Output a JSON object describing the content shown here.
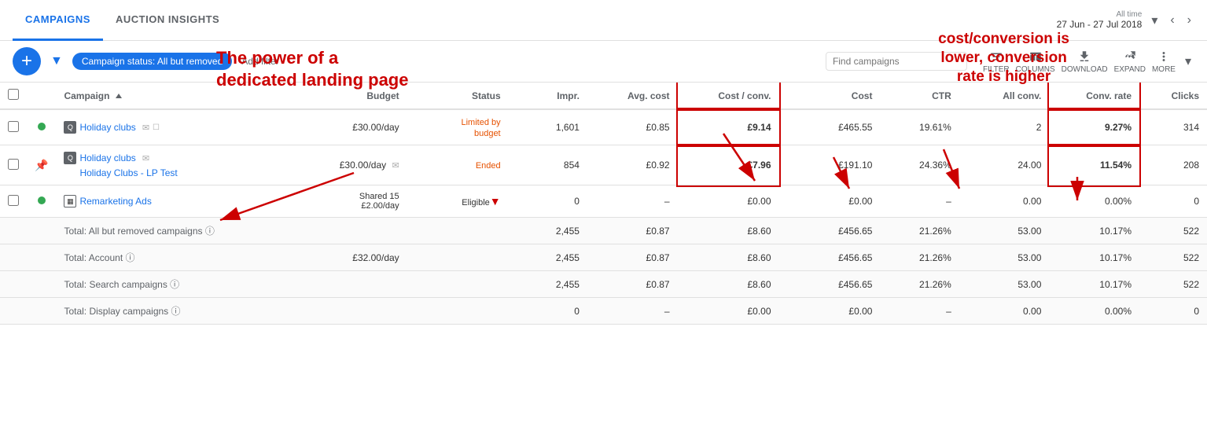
{
  "tabs": [
    {
      "id": "campaigns",
      "label": "CAMPAIGNS",
      "active": true
    },
    {
      "id": "auction-insights",
      "label": "AUCTION INSIGHTS",
      "active": false
    }
  ],
  "dateRange": {
    "allTime": "All time",
    "value": "27 Jun - 27 Jul 2018"
  },
  "toolbar": {
    "addLabel": "+",
    "filterTag": "Campaign status: All but removed",
    "addFilterLabel": "Add filter",
    "searchPlaceholder": "Find campaigns",
    "filterLabel": "FILTER",
    "columnsLabel": "COLUMNS",
    "downloadLabel": "DOWNLOAD",
    "expandLabel": "EXPAND",
    "moreLabel": "MORE"
  },
  "annotation1": "The power of a\ndedicated landing page",
  "annotation2": "cost/conversion is\nlower, conversion\nrate is higher",
  "table": {
    "headers": [
      "",
      "",
      "Campaign ↑",
      "Budget",
      "Status",
      "Impr.",
      "Avg. cost",
      "Cost / conv.",
      "Cost",
      "CTR",
      "All conv.",
      "Conv. rate",
      "Clicks"
    ],
    "rows": [
      {
        "checkbox": true,
        "status_dot": "green",
        "icon": "search",
        "campaign": "Holiday clubs",
        "campaign_sub": "",
        "budget": "£30.00/day",
        "status": "Limited by budget",
        "impr": "1,601",
        "avg_cost": "£0.85",
        "cost_conv": "£9.14",
        "cost": "£465.55",
        "ctr": "19.61%",
        "all_conv": "2",
        "conv_rate": "9.27%",
        "clicks": "314"
      },
      {
        "checkbox": true,
        "status_dot": "pin",
        "icon": "search",
        "campaign": "Holiday clubs",
        "campaign_sub": "Holiday Clubs - LP Test",
        "budget": "£30.00/day",
        "status": "Ended",
        "impr": "854",
        "avg_cost": "£0.92",
        "cost_conv": "£7.96",
        "cost": "£191.10",
        "ctr": "24.36%",
        "all_conv": "24.00",
        "conv_rate": "11.54%",
        "clicks": "208"
      },
      {
        "checkbox": true,
        "status_dot": "green",
        "icon": "display",
        "campaign": "Remarketing Ads",
        "campaign_sub": "",
        "budget": "Shared 15\n£2.00/day",
        "status": "Eligible",
        "impr": "0",
        "avg_cost": "–",
        "cost_conv": "£0.00",
        "cost": "£0.00",
        "ctr": "–",
        "all_conv": "0.00",
        "conv_rate": "0.00%",
        "clicks": "0"
      }
    ],
    "totals": [
      {
        "label": "Total: All but removed campaigns ⓘ",
        "budget": "",
        "status": "",
        "impr": "2,455",
        "avg_cost": "£0.87",
        "cost_conv": "£8.60",
        "cost": "£456.65",
        "ctr": "21.26%",
        "all_conv": "53.00",
        "conv_rate": "10.17%",
        "clicks": "522"
      },
      {
        "label": "Total: Account ⓘ",
        "budget": "£32.00/day",
        "status": "",
        "impr": "2,455",
        "avg_cost": "£0.87",
        "cost_conv": "£8.60",
        "cost": "£456.65",
        "ctr": "21.26%",
        "all_conv": "53.00",
        "conv_rate": "10.17%",
        "clicks": "522"
      },
      {
        "label": "Total: Search campaigns ⓘ",
        "budget": "",
        "status": "",
        "impr": "2,455",
        "avg_cost": "£0.87",
        "cost_conv": "£8.60",
        "cost": "£456.65",
        "ctr": "21.26%",
        "all_conv": "53.00",
        "conv_rate": "10.17%",
        "clicks": "522"
      },
      {
        "label": "Total: Display campaigns ⓘ",
        "budget": "",
        "status": "",
        "impr": "0",
        "avg_cost": "–",
        "cost_conv": "£0.00",
        "cost": "£0.00",
        "ctr": "–",
        "all_conv": "0.00",
        "conv_rate": "0.00%",
        "clicks": "0"
      }
    ]
  }
}
